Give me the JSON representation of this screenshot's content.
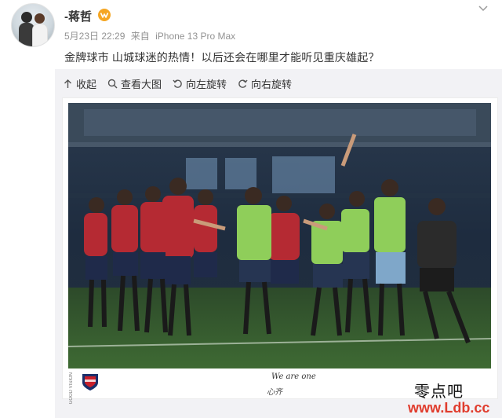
{
  "post": {
    "username": "-蒋哲",
    "date": "5月23日 22:29",
    "source_prefix": "来自",
    "source_device": "iPhone 13 Pro Max",
    "text": "金牌球市 山城球迷的热情！以后还会在哪里才能听见重庆雄起？"
  },
  "toolbar": {
    "collect_label": "收起",
    "view_large_label": "查看大图",
    "rotate_left_label": "向左旋转",
    "rotate_right_label": "向右旋转"
  },
  "image": {
    "caption_en": "We are one",
    "caption_cn": "心齐",
    "credit_vertical": "GOOD VISION"
  },
  "watermark": {
    "site_name": "零点吧",
    "url": "www.Ldb.cc"
  },
  "colors": {
    "vip_badge": "#f5a623",
    "watermark_url": "#e03c2d",
    "meta_gray": "#939393",
    "panel_bg": "#f2f2f5"
  }
}
